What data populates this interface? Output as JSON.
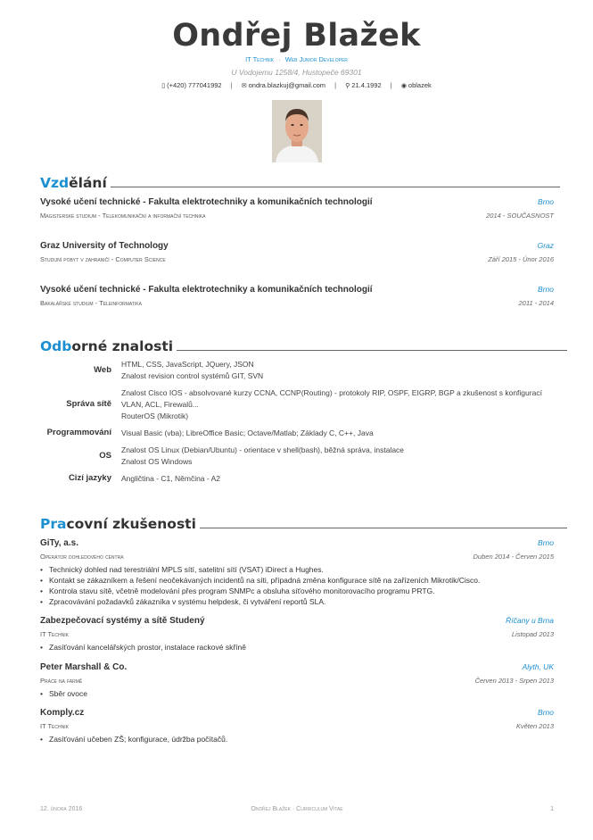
{
  "header": {
    "name": "Ondřej Blažek",
    "position_1": "IT Technik",
    "position_sep": "·",
    "position_2": "Web Junior Developer",
    "address": "U Vodojemu 1258/4, Hustopeče 69301",
    "phone": "(+420) 777041992",
    "email": "ondra.blazkuj@gmail.com",
    "birthdate": "21.4.1992",
    "github": "oblazek"
  },
  "sections": {
    "education": {
      "title_accent": "Vzd",
      "title_rest": "ělání"
    },
    "skills": {
      "title_accent": "Odb",
      "title_rest": "orné znalosti"
    },
    "experience": {
      "title_accent": "Pra",
      "title_rest": "covní zkušenosti"
    }
  },
  "education": [
    {
      "title": "Vysoké učení technické - Fakulta elektrotechniky a komunikačních technologií",
      "location": "Brno",
      "subtitle": "Magisterské studium - Telekomunikační a informační technika",
      "date": "2014 - SOUČASNOST"
    },
    {
      "title": "Graz University of Technology",
      "location": "Graz",
      "subtitle": "Studijní pobyt v zahraničí - Computer Science",
      "date": "Září 2015 - Únor 2016"
    },
    {
      "title": "Vysoké učení technické - Fakulta elektrotechniky a komunikačních technologií",
      "location": "Brno",
      "subtitle": "Bakalářské studium - Teleinformatika",
      "date": "2011 - 2014"
    }
  ],
  "skills": [
    {
      "label": "Web",
      "lines": [
        "HTML, CSS, JavaScript, JQuery, JSON",
        "Znalost revision control systémů GIT, SVN"
      ]
    },
    {
      "label": "Správa sítě",
      "lines": [
        "Znalost Cisco IOS - absolvované kurzy CCNA, CCNP(Routing) - protokoly RIP, OSPF, EIGRP, BGP a zkušenost s konfigurací VLAN, ACL, Firewalů...",
        "RouterOS (Mikrotik)"
      ]
    },
    {
      "label": "Programmování",
      "lines": [
        "Visual Basic (vba); LibreOffice Basic; Octave/Matlab; Základy C, C++, Java"
      ]
    },
    {
      "label": "OS",
      "lines": [
        "Znalost OS Linux (Debian/Ubuntu) - orientace v shell(bash), běžná správa, instalace",
        "Znalost OS Windows"
      ]
    },
    {
      "label": "Cizí jazyky",
      "lines": [
        "Angličtina - C1, Němčina - A2"
      ]
    }
  ],
  "experience": [
    {
      "title": "GiTy, a.s.",
      "location": "Brno",
      "subtitle": "Operátor dohledového centra",
      "date": "Duben 2014 - Červen 2015",
      "bullets": [
        "Technický dohled nad terestriální MPLS sítí, satelitní sítí (VSAT) iDirect a Hughes.",
        "Kontakt se zákazníkem a řešení neočekávaných incidentů na síti, případná změna konfigurace sítě na zařízeních Mikrotik/Cisco.",
        "Kontrola stavu sítě, včetně modelování přes program SNMPc a obsluha síťového monitorovacího programu PRTG.",
        "Zpracovávání požadavků zákazníka v systému helpdesk, či vytváření reportů SLA."
      ]
    },
    {
      "title": "Zabezpečovací systémy a sítě Studený",
      "location": "Říčany u Brna",
      "subtitle": "IT Technik",
      "date": "Listopad 2013",
      "bullets": [
        "Zasíťování kancelářských prostor, instalace rackové skříně"
      ]
    },
    {
      "title": "Peter Marshall & Co.",
      "location": "Alyth, UK",
      "subtitle": "Práce na farmě",
      "date": "Červen 2013 - Srpen 2013",
      "bullets": [
        "Sběr ovoce"
      ]
    },
    {
      "title": "Komply.cz",
      "location": "Brno",
      "subtitle": "IT Technik",
      "date": "Květen 2013",
      "bullets": [
        "Zasíťování učeben ZŠ; konfigurace, údržba počítačů."
      ]
    }
  ],
  "footer": {
    "date": "12. února 2016",
    "center": "Ondřej Blažek · Curriculum Vitae",
    "page": "1"
  },
  "colors": {
    "accent": "#1c8fd0",
    "text": "#333333"
  }
}
